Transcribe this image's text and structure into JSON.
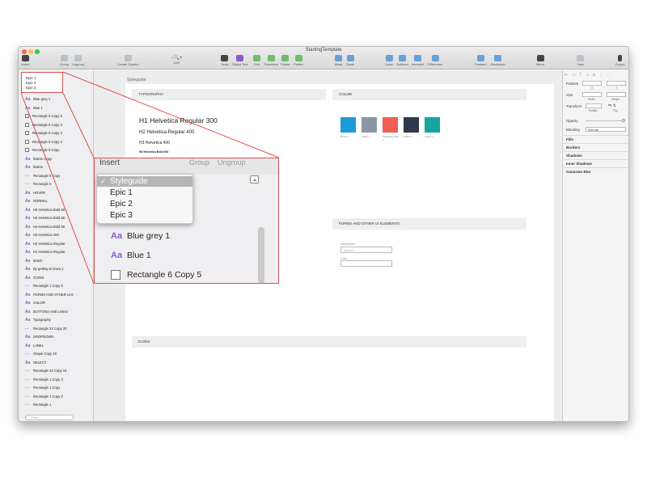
{
  "window": {
    "title": "StartingTemplate"
  },
  "toolbar": {
    "insert": "Insert",
    "group": "Group",
    "ungroup": "Ungroup",
    "create_symbol": "Create Symbol",
    "zoom": "44%",
    "tools": "Tools",
    "styled_text": "Styled Text",
    "edit": "Edit",
    "transform": "Transform",
    "rotate": "Rotate",
    "flatten": "Flatten",
    "mask": "Mask",
    "scale": "Scale",
    "union": "Union",
    "subtract": "Subtract",
    "intersect": "Intersect",
    "difference": "Difference",
    "forward": "Forward",
    "backward": "Backward",
    "mirror": "Mirror",
    "view": "View",
    "export": "Export"
  },
  "mini_dropdown": [
    "Epic 1",
    "Epic 2",
    "Epic 3"
  ],
  "layers": [
    {
      "icon": "text",
      "label": "Blue grey 1"
    },
    {
      "icon": "text",
      "label": "Blue 1"
    },
    {
      "icon": "rect",
      "label": "Rectangle 6 Copy 5"
    },
    {
      "icon": "rect",
      "label": "Rectangle 6 Copy 4"
    },
    {
      "icon": "rect",
      "label": "Rectangle 6 Copy 3"
    },
    {
      "icon": "rect",
      "label": "Rectangle 6 Copy 2"
    },
    {
      "icon": "rect",
      "label": "Rectangle 6 Copy"
    },
    {
      "icon": "text",
      "label": "Button Copy"
    },
    {
      "icon": "text",
      "label": "Button"
    },
    {
      "icon": "line",
      "label": "Rectangle 6 Copy"
    },
    {
      "icon": "line",
      "label": "Rectangle 6"
    },
    {
      "icon": "text",
      "label": "HOVER"
    },
    {
      "icon": "text",
      "label": "NORMAL"
    },
    {
      "icon": "text",
      "label": "H6 Helvetica Bold 60"
    },
    {
      "icon": "text",
      "label": "H5 Helvetica Bold 60"
    },
    {
      "icon": "text",
      "label": "H4 Helvetica Bold 60"
    },
    {
      "icon": "text",
      "label": "H3 Helvetica 400"
    },
    {
      "icon": "text",
      "label": "H2 Helvetica Regular"
    },
    {
      "icon": "text",
      "label": "H1 Helvetica Regular"
    },
    {
      "icon": "text",
      "label": "Match"
    },
    {
      "icon": "text",
      "label": "By getting to know y"
    },
    {
      "icon": "text",
      "label": "ICONS"
    },
    {
      "icon": "line",
      "label": "Rectangle 1 Copy 5"
    },
    {
      "icon": "text",
      "label": "FORMS AND OTHER UI E"
    },
    {
      "icon": "text",
      "label": "COLOR"
    },
    {
      "icon": "text",
      "label": "BUTTONS AND LINKS"
    },
    {
      "icon": "text",
      "label": "Typography"
    },
    {
      "icon": "line",
      "label": "Rectangle 23 Copy 20"
    },
    {
      "icon": "text",
      "label": "DROPDOWN"
    },
    {
      "icon": "text",
      "label": "LABEL"
    },
    {
      "icon": "line",
      "label": "Shape Copy 19"
    },
    {
      "icon": "text",
      "label": "SELECT"
    },
    {
      "icon": "line",
      "label": "Rectangle 23 Copy 16"
    },
    {
      "icon": "line",
      "label": "Rectangle 1 Copy 3"
    },
    {
      "icon": "line",
      "label": "Rectangle 1 Copy"
    },
    {
      "icon": "line",
      "label": "Rectangle 1 Copy 2"
    },
    {
      "icon": "line",
      "label": "Rectangle 1"
    }
  ],
  "filter_placeholder": "Filter",
  "canvas": {
    "artboard_name": "Styleguide",
    "typography_title": "TYPOGRAPHY",
    "color_title": "COLOR",
    "h1": "H1 Helvetica Regular 300",
    "h2": "H2 Helvetica Regular 400",
    "h3": "H3 Helvetica 400",
    "h4": "H4 Helvetica Bold 600",
    "forms_title": "FORMS AND OTHER UI ELEMENTS",
    "dropdown_label": "DROPDOWN",
    "select_value": "SELECT",
    "label_text": "LABEL",
    "icons_title": "ICONS",
    "swatches": [
      {
        "color": "#1a9bd7",
        "label": "BLUE 1"
      },
      {
        "color": "#8a96a3",
        "label": "GREY 2"
      },
      {
        "color": "#f25d55",
        "label": "ORANGE RED 2"
      },
      {
        "color": "#2f3a4a",
        "label": "DARK 1"
      },
      {
        "color": "#16a5a0",
        "label": "TEAL 1"
      }
    ]
  },
  "inspector": {
    "position": "Position",
    "x": "X",
    "y": "Y",
    "size": "Size",
    "width": "Width",
    "height": "Height",
    "transform": "Transform",
    "rotate": "Rotate",
    "flip": "Flip",
    "opacity": "Opacity",
    "blending": "Blending",
    "blending_value": "Normal",
    "fills": "Fills",
    "borders": "Borders",
    "shadows": "Shadows",
    "inner_shadows": "Inner Shadows",
    "gaussian_blur": "Gaussian Blur"
  },
  "zoom_panel": {
    "insert": "Insert",
    "group": "Group",
    "ungroup": "Ungroup",
    "dropdown": [
      {
        "label": "Styleguide",
        "selected": true
      },
      {
        "label": "Epic 1",
        "selected": false
      },
      {
        "label": "Epic 2",
        "selected": false
      },
      {
        "label": "Epic 3",
        "selected": false
      }
    ],
    "layers": [
      {
        "icon": "text",
        "label": "Blue grey 1"
      },
      {
        "icon": "text",
        "label": "Blue 1"
      },
      {
        "icon": "rect",
        "label": "Rectangle 6 Copy 5"
      }
    ]
  },
  "colors": {
    "annotation_red": "#d9534f",
    "accent_purple": "#8a5cc8"
  }
}
